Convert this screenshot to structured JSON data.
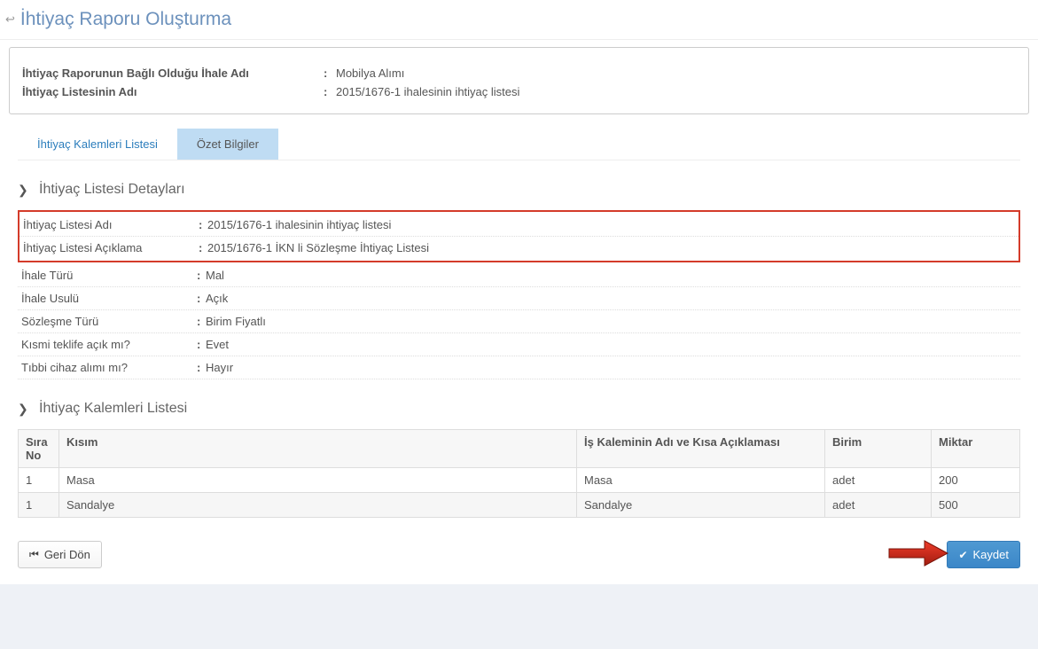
{
  "page": {
    "title": "İhtiyaç Raporu Oluşturma"
  },
  "info_panel": {
    "row1_label": "İhtiyaç Raporunun Bağlı Olduğu İhale Adı",
    "row1_value": "Mobilya Alımı",
    "row2_label": "İhtiyaç Listesinin Adı",
    "row2_value": "2015/1676-1 ihalesinin ihtiyaç listesi"
  },
  "tabs": {
    "ihtiyac_kalemleri": "İhtiyaç Kalemleri Listesi",
    "ozet_bilgiler": "Özet Bilgiler"
  },
  "details_section": {
    "title": "İhtiyaç Listesi Detayları",
    "rows": [
      {
        "label": "İhtiyaç Listesi Adı",
        "value": "2015/1676-1 ihalesinin ihtiyaç listesi",
        "highlight": true
      },
      {
        "label": "İhtiyaç Listesi Açıklama",
        "value": "2015/1676-1 İKN li  Sözleşme İhtiyaç Listesi",
        "highlight": true
      },
      {
        "label": "İhale Türü",
        "value": "Mal"
      },
      {
        "label": "İhale Usulü",
        "value": "Açık"
      },
      {
        "label": "Sözleşme Türü",
        "value": "Birim Fiyatlı"
      },
      {
        "label": "Kısmi teklife açık mı?",
        "value": "Evet"
      },
      {
        "label": "Tıbbi cihaz alımı mı?",
        "value": "Hayır"
      }
    ]
  },
  "items_section": {
    "title": "İhtiyaç Kalemleri Listesi"
  },
  "table": {
    "headers": {
      "sira": "Sıra No",
      "kisim": "Kısım",
      "adi": "İş Kaleminin Adı ve Kısa Açıklaması",
      "birim": "Birim",
      "miktar": "Miktar"
    },
    "rows": [
      {
        "sira": "1",
        "kisim": "Masa",
        "adi": "Masa",
        "birim": "adet",
        "miktar": "200"
      },
      {
        "sira": "1",
        "kisim": "Sandalye",
        "adi": "Sandalye",
        "birim": "adet",
        "miktar": "500"
      }
    ]
  },
  "buttons": {
    "back": "Geri Dön",
    "save": "Kaydet"
  }
}
